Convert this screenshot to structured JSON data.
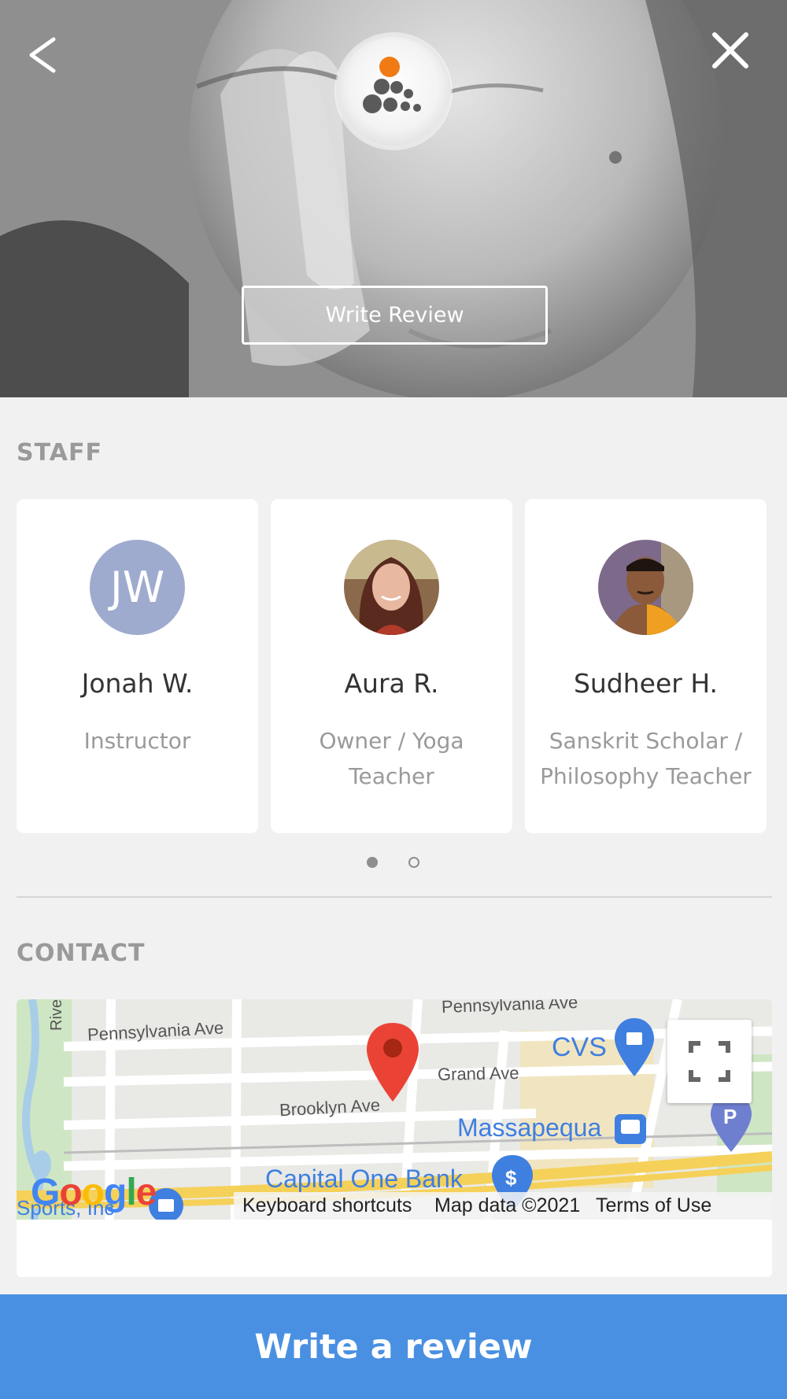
{
  "hero": {
    "write_review_label": "Write Review",
    "back_icon": "chevron-left-icon",
    "close_icon": "close-icon"
  },
  "staff": {
    "title": "STAFF",
    "members": [
      {
        "initials": "JW",
        "name": "Jonah W.",
        "role": "Instructor"
      },
      {
        "initials": "",
        "name": "Aura R.",
        "role": "Owner / Yoga Teacher"
      },
      {
        "initials": "",
        "name": "Sudheer H.",
        "role": "Sanskrit Scholar / Philosophy Teacher"
      }
    ],
    "pagination": {
      "current": 1,
      "total": 2
    }
  },
  "contact": {
    "title": "CONTACT",
    "map": {
      "streets": [
        "Pennsylvania Ave",
        "Pennsylvania Ave",
        "Grand Ave",
        "Brooklyn Ave",
        "Rivers"
      ],
      "places": [
        "CVS",
        "Massapequa",
        "Capital One Bank",
        "Sports, Inc"
      ],
      "google_logo": "Google",
      "attribution": {
        "keyboard": "Keyboard shortcuts",
        "map_data": "Map data ©2021",
        "terms": "Terms of Use"
      }
    }
  },
  "bottom_button_label": "Write a review",
  "colors": {
    "accent": "#4a90e2",
    "avatar_bg": "#9eabcf",
    "section_title": "#9a9a9a",
    "pin_red": "#ea4335",
    "map_blue": "#3f7fe0"
  }
}
